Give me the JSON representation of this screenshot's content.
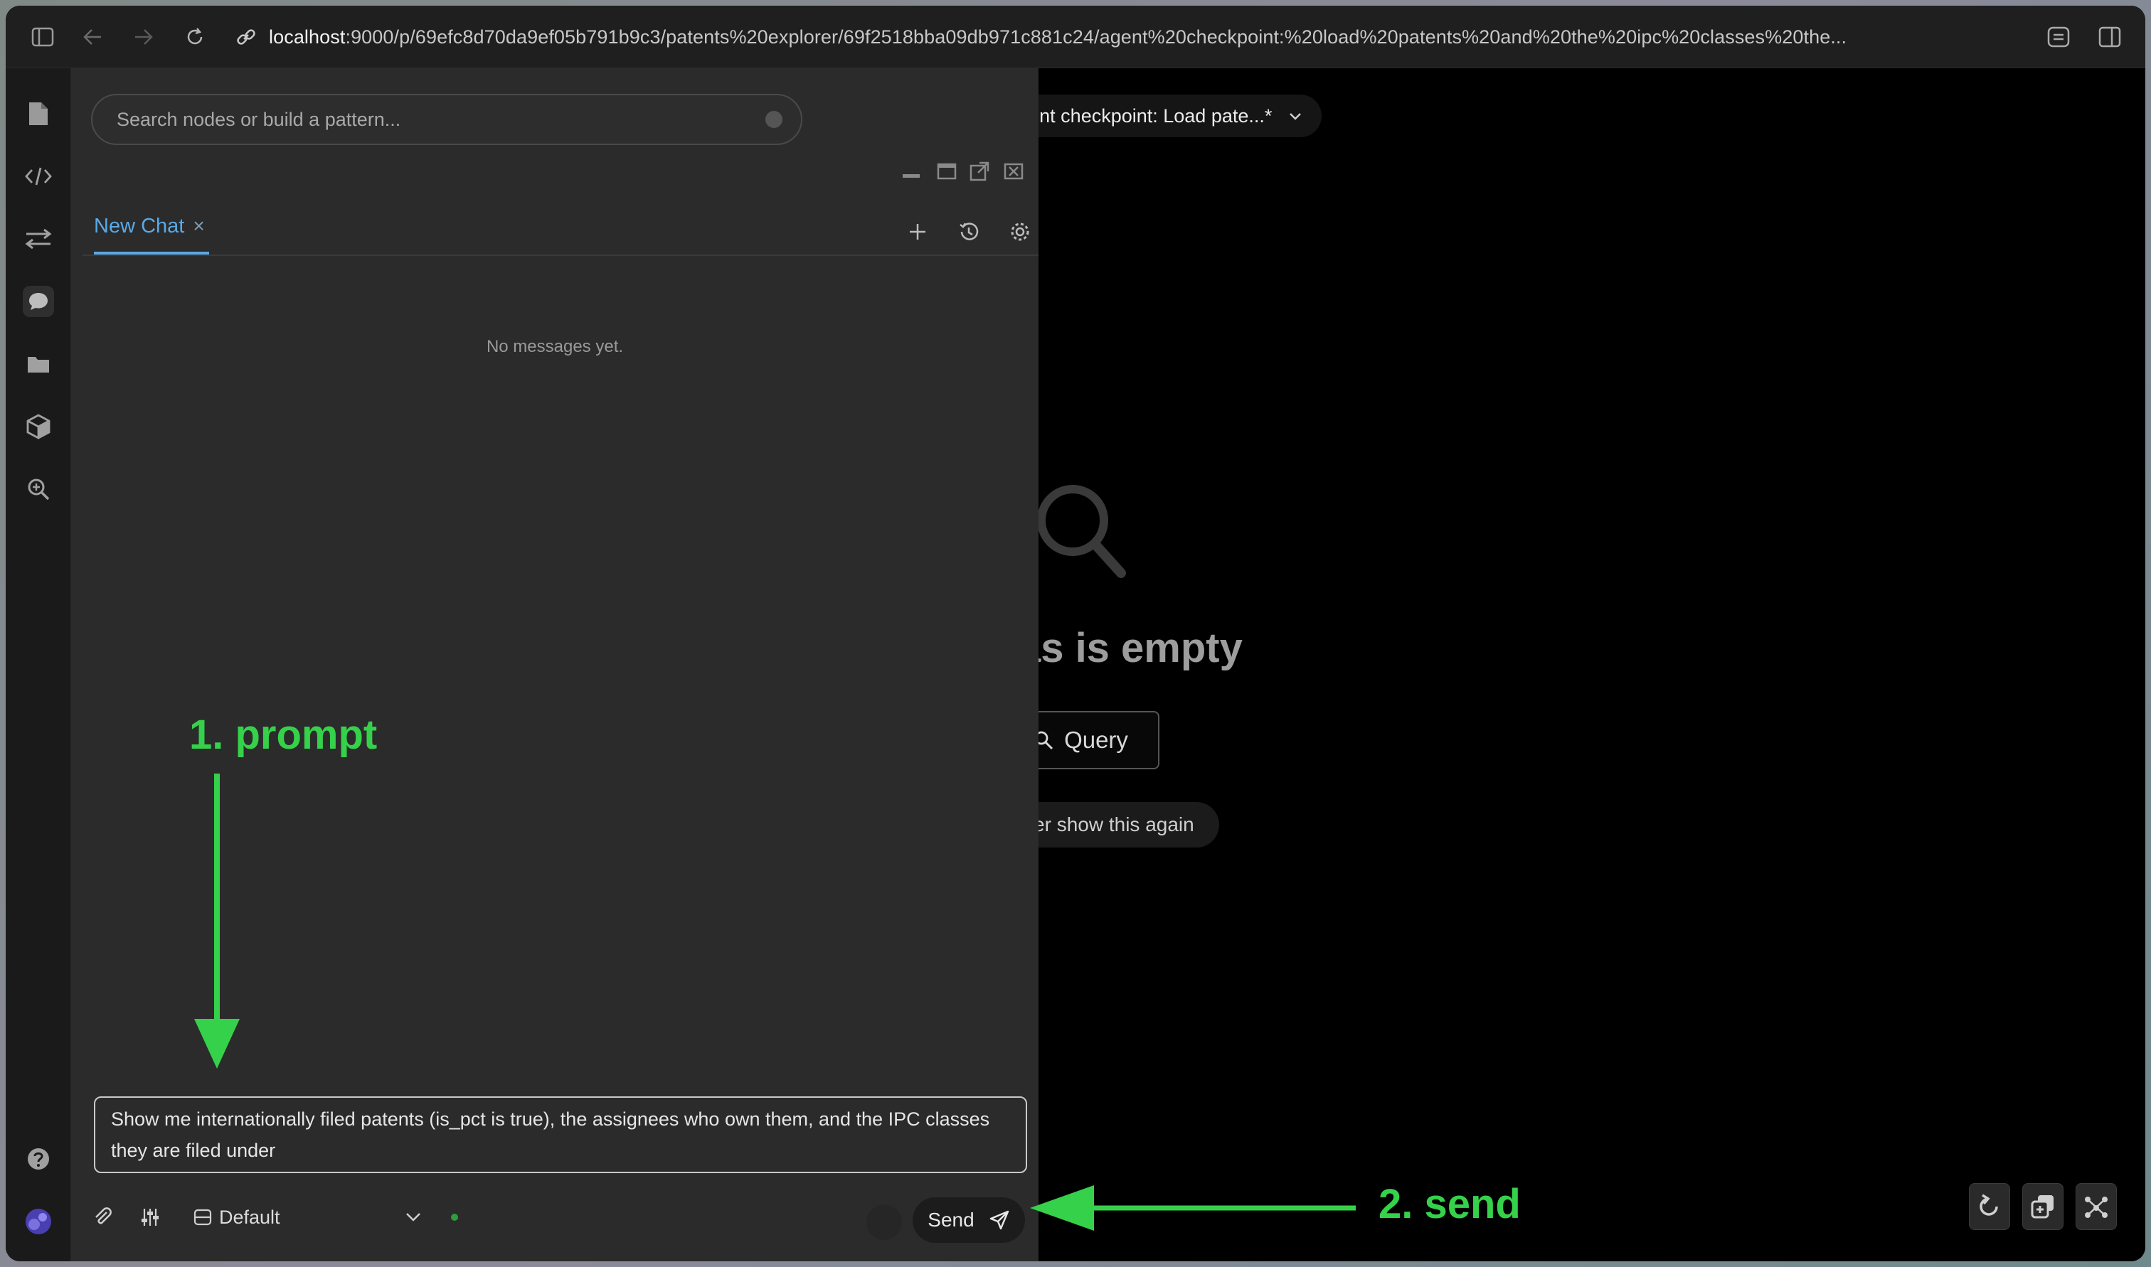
{
  "browser": {
    "url_host": "localhost",
    "url_rest": ":9000/p/69efc8d70da9ef05b791b9c3/patents%20explorer/69f2518bba09db971c881c24/agent%20checkpoint:%20load%20patents%20and%20the%20ipc%20classes%20the..."
  },
  "search": {
    "placeholder": "Search nodes or build a pattern..."
  },
  "breadcrumb": "Patents Explorer / agent checkpoint: Load pate...*",
  "chat": {
    "tab_label": "New Chat",
    "tab_close": "×",
    "empty_text": "No messages yet.",
    "prompt_text": "Show me internationally filed patents (is_pct is true), the assignees who own them, and the IPC classes they are filed under",
    "model": "Default",
    "send_label": "Send"
  },
  "canvas": {
    "empty_title": "Canvas is empty",
    "query_label": "Query",
    "never_label": "Never show this again"
  },
  "annotations": {
    "step1": "1. prompt",
    "step2": "2. send"
  },
  "colors": {
    "accent": "#5aa9e6",
    "annotation": "#36d14a",
    "status_dot": "#2e9e3a"
  }
}
